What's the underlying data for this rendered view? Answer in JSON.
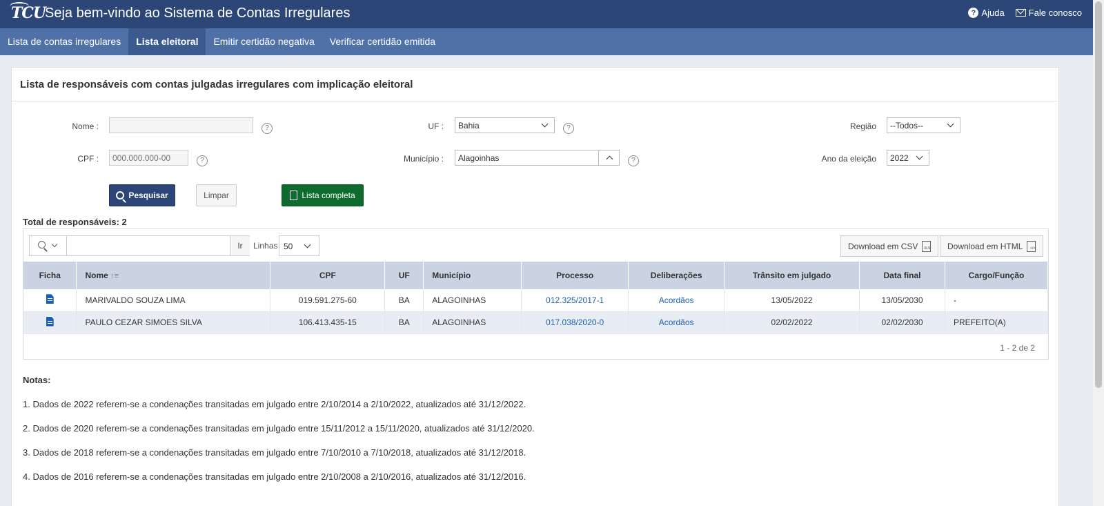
{
  "header": {
    "logo": "TCU",
    "title": "Seja bem-vindo ao Sistema de Contas Irregulares",
    "help_label": "Ajuda",
    "contact_label": "Fale conosco"
  },
  "nav": {
    "items": [
      {
        "label": "Lista de contas irregulares"
      },
      {
        "label": "Lista eleitoral"
      },
      {
        "label": "Emitir certidão negativa"
      },
      {
        "label": "Verificar certidão emitida"
      }
    ]
  },
  "panel": {
    "title": "Lista de responsáveis com contas julgadas irregulares com implicação eleitoral"
  },
  "form": {
    "nome_label": "Nome :",
    "nome_value": "",
    "cpf_label": "CPF :",
    "cpf_placeholder": "000.000.000-00",
    "uf_label": "UF :",
    "uf_value": "Bahia",
    "municipio_label": "Município :",
    "municipio_value": "Alagoinhas",
    "regiao_label": "Região",
    "regiao_value": "--Todos--",
    "ano_label": "Ano da eleição",
    "ano_value": "2022",
    "help_glyph": "?",
    "search_btn": "Pesquisar",
    "clear_btn": "Limpar",
    "full_list_btn": "Lista completa"
  },
  "results": {
    "total_label": "Total de responsáveis: 2",
    "go_label": "Ir",
    "rows_label": "Linhas",
    "rows_value": "50",
    "csv_btn": "Download em CSV",
    "csv_ico": "XLS",
    "html_btn": "Download em HTML",
    "html_ico": "</>",
    "columns": [
      "Ficha",
      "Nome",
      "CPF",
      "UF",
      "Município",
      "Processo",
      "Deliberações",
      "Trânsito em julgado",
      "Data final",
      "Cargo/Função"
    ],
    "rows": [
      {
        "nome": "MARIVALDO SOUZA LIMA",
        "cpf": "019.591.275-60",
        "uf": "BA",
        "municipio": "ALAGOINHAS",
        "processo": "012.325/2017-1",
        "deliberacoes": "Acordãos",
        "transito": "13/05/2022",
        "data_final": "13/05/2030",
        "cargo": "-"
      },
      {
        "nome": "PAULO CEZAR SIMOES SILVA",
        "cpf": "106.413.435-15",
        "uf": "BA",
        "municipio": "ALAGOINHAS",
        "processo": "017.038/2020-0",
        "deliberacoes": "Acordãos",
        "transito": "02/02/2022",
        "data_final": "02/02/2030",
        "cargo": "PREFEITO(A)"
      }
    ],
    "pager": "1 - 2 de 2"
  },
  "notes": {
    "title": "Notas:",
    "items": [
      "1. Dados de 2022 referem-se a condenações transitadas em julgado entre 2/10/2014 a 2/10/2022, atualizados até 31/12/2022.",
      "2. Dados de 2020 referem-se a condenações transitadas em julgado entre 15/11/2012 a 15/11/2020, atualizados até 31/12/2020.",
      "3. Dados de 2018 referem-se a condenações transitadas em julgado entre 7/10/2010 a 7/10/2018, atualizados até 31/12/2018.",
      "4. Dados de 2016 referem-se a condenações transitadas em julgado entre 2/10/2008 a 2/10/2016, atualizados até 31/12/2016."
    ]
  },
  "colors": {
    "header_bg": "#2c4777",
    "nav_bg": "#5071a8",
    "table_header_bg": "#c9d3e1",
    "link": "#1a5fb4",
    "success": "#0d6b2e"
  }
}
